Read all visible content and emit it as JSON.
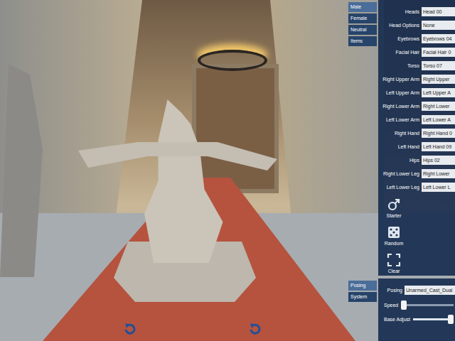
{
  "gender_tabs": [
    {
      "label": "Male",
      "selected": true
    },
    {
      "label": "Female",
      "selected": false
    },
    {
      "label": "Neutral",
      "selected": false
    },
    {
      "label": "Items",
      "selected": false
    }
  ],
  "parts": [
    {
      "label": "Heads",
      "value": "Head 00"
    },
    {
      "label": "Head Options",
      "value": "None"
    },
    {
      "label": "Eyebrows",
      "value": "Eyebrows 04"
    },
    {
      "label": "Facial Hair",
      "value": "Facial Hair 0"
    },
    {
      "label": "Torso",
      "value": "Torso 07"
    },
    {
      "label": "Right Upper Arm",
      "value": "Right Upper"
    },
    {
      "label": "Left Upper Arm",
      "value": "Left Upper A"
    },
    {
      "label": "Right Lower Arm",
      "value": "Right Lower"
    },
    {
      "label": "Left Lower Arm",
      "value": "Left Lower A"
    },
    {
      "label": "Right Hand",
      "value": "Right Hand 0"
    },
    {
      "label": "Left Hand",
      "value": "Left Hand 09"
    },
    {
      "label": "Hips",
      "value": "Hips 02"
    },
    {
      "label": "Right Lower Leg",
      "value": "Right Lower"
    },
    {
      "label": "Left Lower Leg",
      "value": "Left Lower L"
    }
  ],
  "actions": [
    {
      "label": "Starter",
      "kind": "male"
    },
    {
      "label": "Random",
      "kind": "dice"
    },
    {
      "label": "Clear",
      "kind": "clear"
    }
  ],
  "bottom_tabs": [
    {
      "label": "Posing",
      "selected": true
    },
    {
      "label": "System",
      "selected": false
    }
  ],
  "posing": {
    "label": "Posing",
    "value": "Unarmed_Cast_Dual"
  },
  "sliders": [
    {
      "label": "Speed",
      "level": 0.0
    },
    {
      "label": "Base Adjust",
      "level": 1.0
    }
  ],
  "rotate_buttons": [
    {
      "kind": "rotate-left"
    },
    {
      "kind": "rotate-right"
    }
  ]
}
